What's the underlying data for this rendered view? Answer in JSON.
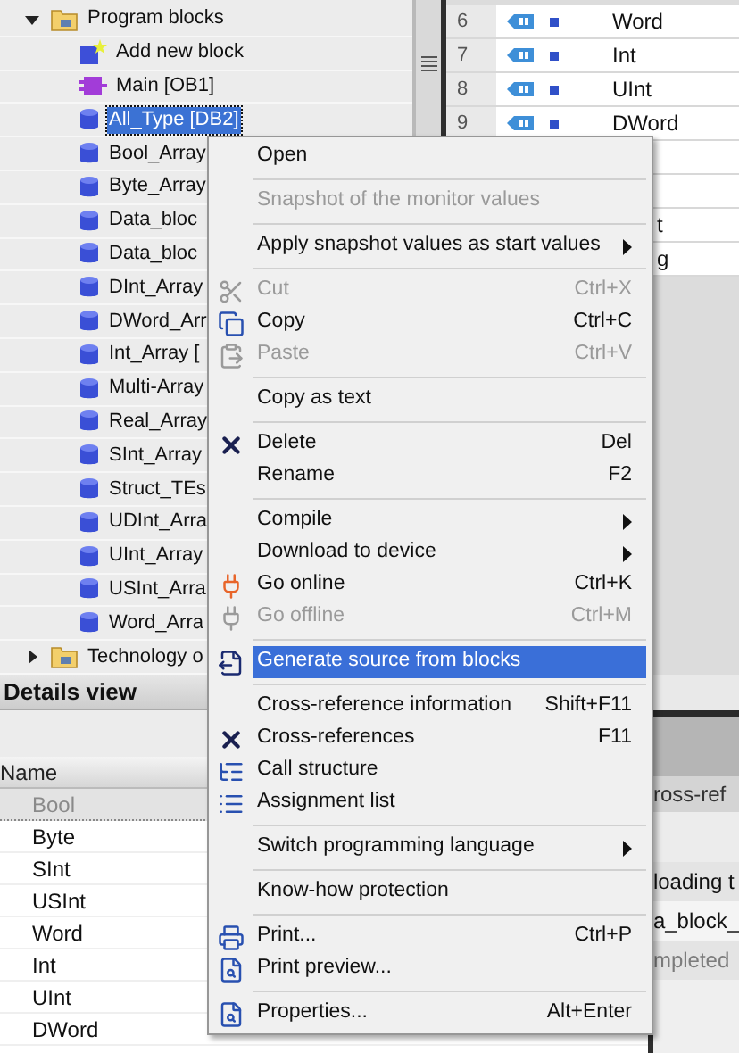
{
  "tree": {
    "items": [
      {
        "label": "Program blocks",
        "kind": "folder",
        "expanded": true,
        "children": [
          {
            "label": "Add new block",
            "kind": "add",
            "selected": false
          },
          {
            "label": "Main [OB1]",
            "kind": "ob",
            "selected": false
          },
          {
            "label": "All_Type [DB2]",
            "kind": "db",
            "selected": true
          },
          {
            "label": "Bool_Array",
            "kind": "db",
            "selected": false
          },
          {
            "label": "Byte_Array",
            "kind": "db",
            "selected": false
          },
          {
            "label": "Data_bloc",
            "kind": "db",
            "selected": false
          },
          {
            "label": "Data_bloc",
            "kind": "db",
            "selected": false
          },
          {
            "label": "DInt_Array",
            "kind": "db",
            "selected": false
          },
          {
            "label": "DWord_Arr",
            "kind": "db",
            "selected": false
          },
          {
            "label": "Int_Array [",
            "kind": "db",
            "selected": false
          },
          {
            "label": "Multi-Array",
            "kind": "db",
            "selected": false
          },
          {
            "label": "Real_Array",
            "kind": "db",
            "selected": false
          },
          {
            "label": "SInt_Array",
            "kind": "db",
            "selected": false
          },
          {
            "label": "Struct_TEs",
            "kind": "db",
            "selected": false
          },
          {
            "label": "UDInt_Arra",
            "kind": "db",
            "selected": false
          },
          {
            "label": "UInt_Array",
            "kind": "db",
            "selected": false
          },
          {
            "label": "USInt_Arra",
            "kind": "db",
            "selected": false
          },
          {
            "label": "Word_Arra",
            "kind": "db",
            "selected": false
          }
        ]
      },
      {
        "label": "Technology o",
        "kind": "folder",
        "expanded": false
      }
    ]
  },
  "table": {
    "rows": [
      {
        "kind": "full",
        "number": "6",
        "name": "Word"
      },
      {
        "kind": "full",
        "number": "7",
        "name": "Int"
      },
      {
        "kind": "full",
        "number": "8",
        "name": "UInt"
      },
      {
        "kind": "full",
        "number": "9",
        "name": "DWord"
      },
      {
        "kind": "hidden"
      },
      {
        "kind": "hidden"
      },
      {
        "kind": "fragment",
        "name": "t"
      },
      {
        "kind": "fragment",
        "name": "g"
      }
    ]
  },
  "details": {
    "title": "Details view",
    "column": "Name",
    "rows": [
      {
        "label": "Bool",
        "selected": true
      },
      {
        "label": "Byte",
        "selected": false
      },
      {
        "label": "SInt",
        "selected": false
      },
      {
        "label": "USInt",
        "selected": false
      },
      {
        "label": "Word",
        "selected": false
      },
      {
        "label": "Int",
        "selected": false
      },
      {
        "label": "UInt",
        "selected": false
      },
      {
        "label": "DWord",
        "selected": false
      }
    ]
  },
  "side_panel": {
    "tab": "ross-ref",
    "lines": [
      {
        "text": "loading t",
        "disabled": false
      },
      {
        "text": "a_block_",
        "disabled": false
      },
      {
        "text": "mpleted",
        "disabled": true
      }
    ]
  },
  "context_menu": {
    "groups": [
      [
        {
          "label": "Open",
          "disabled": false,
          "submenu": false,
          "selected": false
        }
      ],
      [
        {
          "label": "Snapshot of the monitor values",
          "disabled": true,
          "submenu": false,
          "selected": false
        }
      ],
      [
        {
          "label": "Apply snapshot values as start values",
          "disabled": false,
          "submenu": true,
          "selected": false
        }
      ],
      [
        {
          "label": "Cut",
          "shortcut": "Ctrl+X",
          "disabled": true,
          "submenu": false,
          "selected": false
        },
        {
          "label": "Copy",
          "shortcut": "Ctrl+C",
          "disabled": false,
          "submenu": false,
          "selected": false
        },
        {
          "label": "Paste",
          "shortcut": "Ctrl+V",
          "disabled": true,
          "submenu": false,
          "selected": false
        }
      ],
      [
        {
          "label": "Copy as text",
          "disabled": false,
          "submenu": false,
          "selected": false
        }
      ],
      [
        {
          "label": "Delete",
          "shortcut": "Del",
          "disabled": false,
          "submenu": false,
          "selected": false
        },
        {
          "label": "Rename",
          "shortcut": "F2",
          "disabled": false,
          "submenu": false,
          "selected": false
        }
      ],
      [
        {
          "label": "Compile",
          "disabled": false,
          "submenu": true,
          "selected": false
        },
        {
          "label": "Download to device",
          "disabled": false,
          "submenu": true,
          "selected": false
        },
        {
          "label": "Go online",
          "shortcut": "Ctrl+K",
          "disabled": false,
          "submenu": false,
          "selected": false
        },
        {
          "label": "Go offline",
          "shortcut": "Ctrl+M",
          "disabled": true,
          "submenu": false,
          "selected": false
        }
      ],
      [
        {
          "label": "Generate source from blocks",
          "disabled": false,
          "submenu": false,
          "selected": true
        }
      ],
      [
        {
          "label": "Cross-reference information",
          "shortcut": "Shift+F11",
          "disabled": false,
          "submenu": false,
          "selected": false
        },
        {
          "label": "Cross-references",
          "shortcut": "F11",
          "disabled": false,
          "submenu": false,
          "selected": false
        },
        {
          "label": "Call structure",
          "disabled": false,
          "submenu": false,
          "selected": false
        },
        {
          "label": "Assignment list",
          "disabled": false,
          "submenu": false,
          "selected": false
        }
      ],
      [
        {
          "label": "Switch programming language",
          "disabled": false,
          "submenu": true,
          "selected": false
        }
      ],
      [
        {
          "label": "Know-how protection",
          "disabled": false,
          "submenu": false,
          "selected": false
        }
      ],
      [
        {
          "label": "Print...",
          "shortcut": "Ctrl+P",
          "disabled": false,
          "submenu": false,
          "selected": false
        },
        {
          "label": "Print preview...",
          "disabled": false,
          "submenu": false,
          "selected": false
        }
      ],
      [
        {
          "label": "Properties...",
          "shortcut": "Alt+Enter",
          "disabled": false,
          "submenu": false,
          "selected": false
        }
      ]
    ]
  }
}
